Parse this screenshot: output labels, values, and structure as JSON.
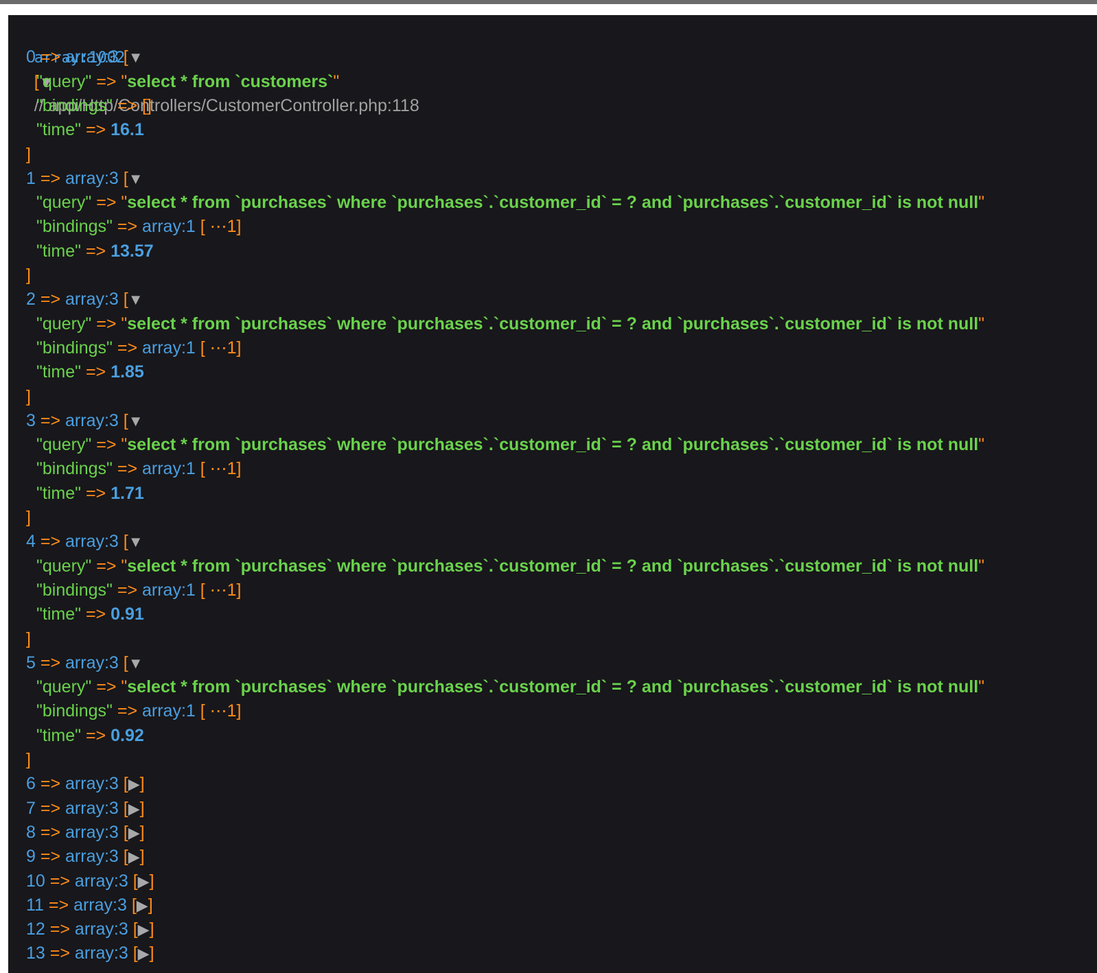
{
  "header": {
    "type": "array:1002",
    "open": "[",
    "toggle": "▼",
    "source": "// app/Http/Controllers/CustomerController.php:118"
  },
  "arrow": "=>",
  "expanded_items": [
    {
      "index": "0",
      "type": "array:3",
      "query": "select * from `customers`",
      "bindings": "[]",
      "bindings_collapsed": false,
      "time": "16.1"
    },
    {
      "index": "1",
      "type": "array:3",
      "query": "select * from `purchases` where `purchases`.`customer_id` = ? and `purchases`.`customer_id` is not null",
      "bindings": "array:1",
      "bindings_collapsed": true,
      "time": "13.57"
    },
    {
      "index": "2",
      "type": "array:3",
      "query": "select * from `purchases` where `purchases`.`customer_id` = ? and `purchases`.`customer_id` is not null",
      "bindings": "array:1",
      "bindings_collapsed": true,
      "time": "1.85"
    },
    {
      "index": "3",
      "type": "array:3",
      "query": "select * from `purchases` where `purchases`.`customer_id` = ? and `purchases`.`customer_id` is not null",
      "bindings": "array:1",
      "bindings_collapsed": true,
      "time": "1.71"
    },
    {
      "index": "4",
      "type": "array:3",
      "query": "select * from `purchases` where `purchases`.`customer_id` = ? and `purchases`.`customer_id` is not null",
      "bindings": "array:1",
      "bindings_collapsed": true,
      "time": "0.91"
    },
    {
      "index": "5",
      "type": "array:3",
      "query": "select * from `purchases` where `purchases`.`customer_id` = ? and `purchases`.`customer_id` is not null",
      "bindings": "array:1",
      "bindings_collapsed": true,
      "time": "0.92"
    }
  ],
  "keys": {
    "query": "\"query\"",
    "bindings": "\"bindings\"",
    "time": "\"time\""
  },
  "collapsed_binding_text": "[ ⋯1]",
  "collapsed_items": [
    {
      "index": "6",
      "type": "array:3"
    },
    {
      "index": "7",
      "type": "array:3"
    },
    {
      "index": "8",
      "type": "array:3"
    },
    {
      "index": "9",
      "type": "array:3"
    },
    {
      "index": "10",
      "type": "array:3"
    },
    {
      "index": "11",
      "type": "array:3"
    },
    {
      "index": "12",
      "type": "array:3"
    },
    {
      "index": "13",
      "type": "array:3"
    }
  ],
  "colors": {
    "background": "#18171b",
    "key": "#6ad24c",
    "number": "#4a9fe0",
    "punct": "#ff8c1a",
    "comment": "#a0a0a0"
  }
}
